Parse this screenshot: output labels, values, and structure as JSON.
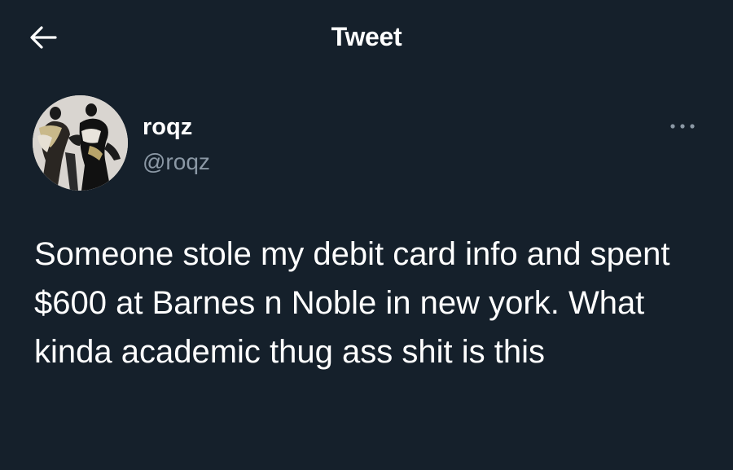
{
  "colors": {
    "background": "#15202b",
    "text_primary": "#ffffff",
    "text_secondary": "#8b98a5"
  },
  "header": {
    "back_icon": "arrow-left-icon",
    "title": "Tweet"
  },
  "tweet": {
    "author": {
      "avatar_icon": "avatar-image",
      "display_name": "roqz",
      "handle": "@roqz"
    },
    "more_icon": "more-horizontal-icon",
    "text": "Someone stole my debit card info and spent $600 at Barnes n Noble in new york. What kinda academic thug ass shit is this"
  }
}
